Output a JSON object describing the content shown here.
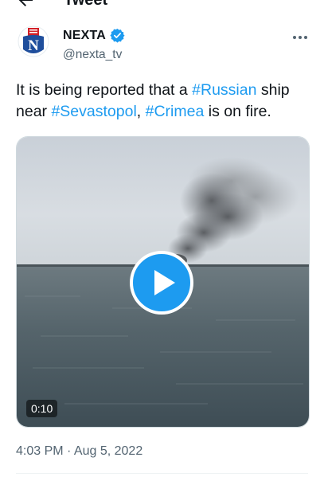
{
  "nav": {
    "title": "Tweet",
    "back_icon": "back-arrow-icon"
  },
  "author": {
    "display_name": "NEXTA",
    "handle": "@nexta_tv",
    "verified_icon": "verified-badge-icon",
    "avatar_letter": "N"
  },
  "tweet": {
    "parts": [
      {
        "text": "It is being reported that a ",
        "hashtag": false
      },
      {
        "text": "#Russian",
        "hashtag": true
      },
      {
        "text": " ship near ",
        "hashtag": false
      },
      {
        "text": "#Sevastopol",
        "hashtag": true
      },
      {
        "text": ", ",
        "hashtag": false
      },
      {
        "text": "#Crimea",
        "hashtag": true
      },
      {
        "text": " is on fire.",
        "hashtag": false
      }
    ],
    "timestamp": "4:03 PM · Aug 5, 2022"
  },
  "media": {
    "duration": "0:10",
    "play_icon": "play-icon"
  },
  "colors": {
    "accent": "#1d9bf0",
    "text": "#0f1419",
    "secondary": "#536471"
  }
}
